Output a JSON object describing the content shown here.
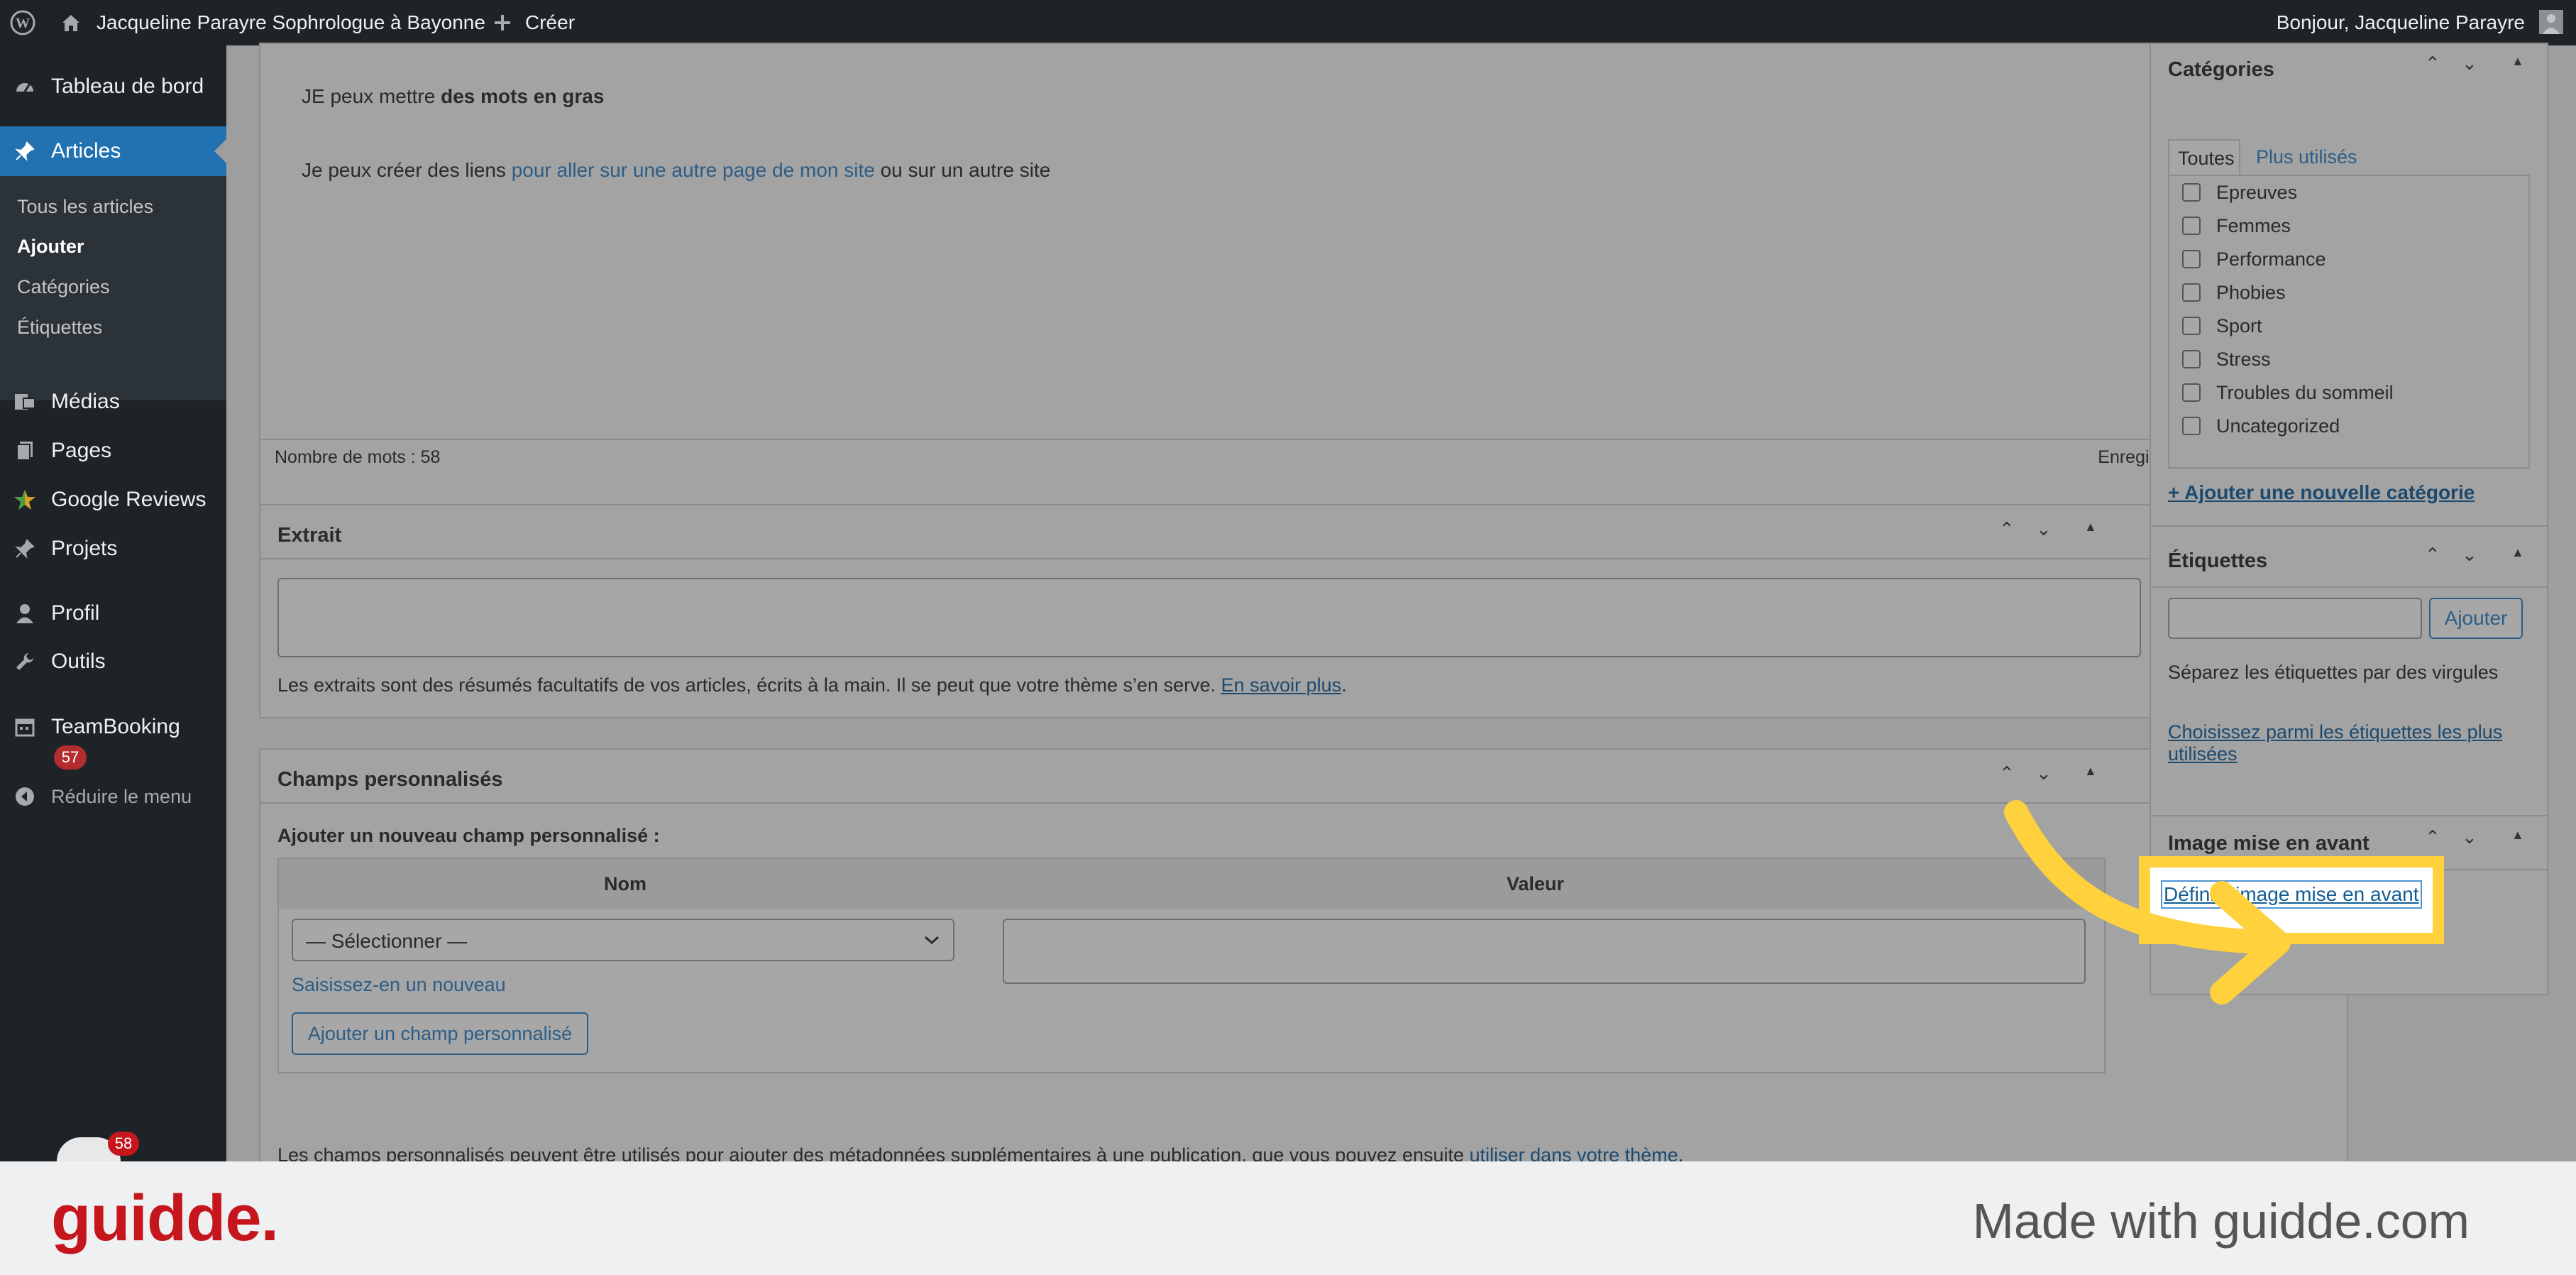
{
  "adminbar": {
    "site_title": "Jacqueline Parayre Sophrologue à Bayonne",
    "new_label": "Créer",
    "greeting": "Bonjour, Jacqueline Parayre"
  },
  "sidebar": {
    "items": [
      {
        "label": "Tableau de bord",
        "icon": "dashboard-icon"
      },
      {
        "label": "Articles",
        "icon": "pin-icon"
      },
      {
        "label": "Médias",
        "icon": "media-icon"
      },
      {
        "label": "Pages",
        "icon": "pages-icon"
      },
      {
        "label": "Google Reviews",
        "icon": "star-icon"
      },
      {
        "label": "Projets",
        "icon": "pin-icon"
      },
      {
        "label": "Profil",
        "icon": "user-icon"
      },
      {
        "label": "Outils",
        "icon": "wrench-icon"
      },
      {
        "label": "TeamBooking",
        "icon": "calendar-icon"
      }
    ],
    "submenu": [
      "Tous les articles",
      "Ajouter",
      "Catégories",
      "Étiquettes"
    ],
    "teambooking_badge": "57",
    "collapse_label": "Réduire le menu",
    "avatar_badge": "58"
  },
  "editor": {
    "line1_prefix": "JE peux mettre ",
    "line1_bold": "des mots en gras",
    "line2_prefix": "Je peux créer des liens ",
    "line2_link": "pour aller sur une autre page de mon site",
    "line2_suffix": " ou sur un autre site",
    "word_count": "Nombre de mots : 58",
    "draft_status": "Enregistrement du brouillon…"
  },
  "excerpt": {
    "title": "Extrait",
    "help_text": "Les extraits sont des résumés facultatifs de vos articles, écrits à la main. Il se peut que votre thème s’en serve. ",
    "help_link": "En savoir plus",
    "help_end": "."
  },
  "custom_fields": {
    "title": "Champs personnalisés",
    "add_heading": "Ajouter un nouveau champ personnalisé :",
    "col_name": "Nom",
    "col_value": "Valeur",
    "select_value": "— Sélectionner —",
    "enter_new": "Saisissez-en un nouveau",
    "add_button": "Ajouter un champ personnalisé",
    "help_text": "Les champs personnalisés peuvent être utilisés pour ajouter des métadonnées supplémentaires à une publication, que vous pouvez ensuite ",
    "help_link": "utiliser dans votre thème",
    "help_end": "."
  },
  "categories": {
    "title": "Catégories",
    "tab_all": "Toutes",
    "tab_popular": "Plus utilisés",
    "items": [
      "Epreuves",
      "Femmes",
      "Performance",
      "Phobies",
      "Sport",
      "Stress",
      "Troubles du sommeil",
      "Uncategorized"
    ],
    "add_link": "+ Ajouter une nouvelle catégorie"
  },
  "tags": {
    "title": "Étiquettes",
    "add_button": "Ajouter",
    "help": "Séparez les étiquettes par des virgules",
    "choose_line1": "Choisissez parmi les étiquettes les plus",
    "choose_line2": "utilisées"
  },
  "featured_image": {
    "title": "Image mise en avant",
    "set_link": "Définir l’image mise en avant"
  },
  "footer": {
    "logo": "guidde.",
    "made_with": "Made with guidde.com"
  },
  "colors": {
    "highlight": "#ffd13c",
    "brand_red": "#c4161c",
    "admin_dark": "#1d2327",
    "active_blue": "#2271b1"
  }
}
